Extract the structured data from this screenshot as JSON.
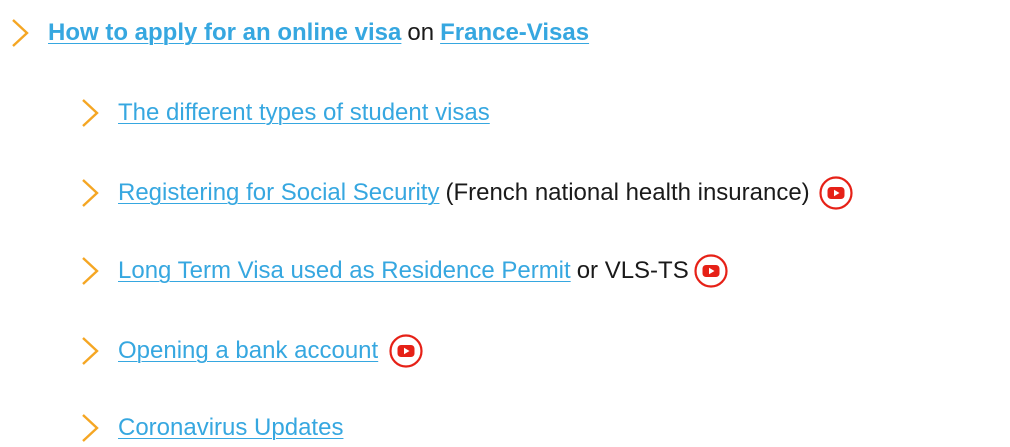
{
  "items": [
    {
      "link": "How to apply for an online visa",
      "middle": "on",
      "link2": "France-Visas"
    },
    {
      "link": "The different types of student visas"
    },
    {
      "link": "Registering for Social Security",
      "after": "(French national health insurance)"
    },
    {
      "link": "Long Term Visa used as Residence Permit",
      "after": "or VLS-TS"
    },
    {
      "link": "Opening a bank account"
    },
    {
      "link": "Coronavirus Updates"
    }
  ],
  "icons": {
    "chevron": "chevron-right-icon",
    "video": "youtube-icon"
  },
  "colors": {
    "link": "#36a7e0",
    "chevron": "#f5a623",
    "youtube": "#e62117",
    "text": "#1a1a1a"
  }
}
